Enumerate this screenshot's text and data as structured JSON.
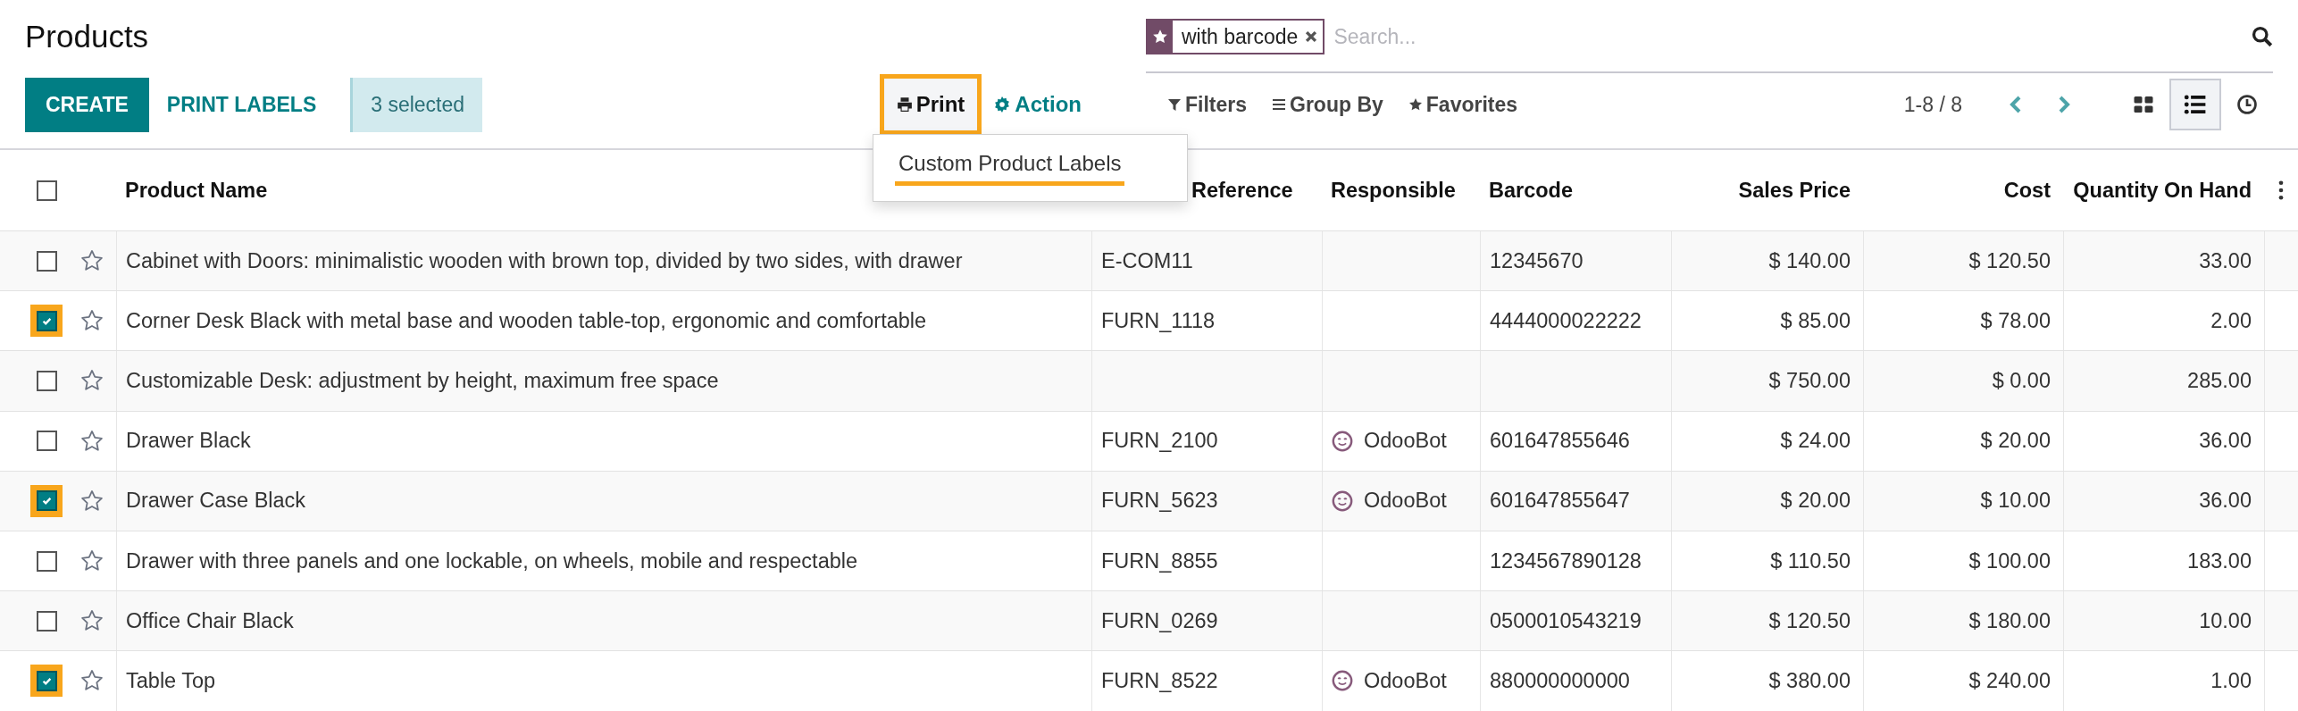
{
  "title": "Products",
  "search": {
    "facet": "with barcode",
    "placeholder": "Search..."
  },
  "create": "CREATE",
  "print_labels": "PRINT LABELS",
  "selection": "3 selected",
  "print": {
    "label": "Print",
    "highlighted": true
  },
  "action": {
    "label": "Action"
  },
  "print_menu": {
    "items": [
      {
        "label": "Custom Product Labels",
        "highlighted": true
      }
    ]
  },
  "search_options": [
    {
      "kind": "filter",
      "label": "Filters"
    },
    {
      "kind": "group",
      "label": "Group By"
    },
    {
      "kind": "favorite",
      "label": "Favorites"
    }
  ],
  "pager": "1-8 / 8",
  "views": [
    {
      "kind": "kanban",
      "selected": false
    },
    {
      "kind": "list",
      "selected": true
    },
    {
      "kind": "activity",
      "selected": false
    }
  ],
  "table": {
    "all_selected": false,
    "columns": [
      "Product Name",
      "Reference",
      "Responsible",
      "Barcode",
      "Sales Price",
      "Cost",
      "Quantity On Hand"
    ],
    "rows": [
      {
        "selected": false,
        "starred": false,
        "name": "Cabinet with Doors: minimalistic wooden with brown top, divided by two sides, with drawer",
        "reference": "E-COM11",
        "barcode": "12345670",
        "sales_price": "$ 140.00",
        "cost": "$ 120.50",
        "quantity": "33.00"
      },
      {
        "selected": true,
        "starred": false,
        "name": "Corner Desk Black with metal base and wooden table-top, ergonomic and comfortable",
        "reference": "FURN_1118",
        "barcode": "4444000022222",
        "sales_price": "$ 85.00",
        "cost": "$ 78.00",
        "quantity": "2.00"
      },
      {
        "selected": false,
        "starred": false,
        "name": "Customizable Desk: adjustment by height, maximum free space",
        "sales_price": "$ 750.00",
        "cost": "$ 0.00",
        "quantity": "285.00"
      },
      {
        "selected": false,
        "starred": false,
        "name": "Drawer Black",
        "reference": "FURN_2100",
        "responsible": "OdooBot",
        "barcode": "601647855646",
        "sales_price": "$ 24.00",
        "cost": "$ 20.00",
        "quantity": "36.00"
      },
      {
        "selected": true,
        "starred": false,
        "name": "Drawer Case Black",
        "reference": "FURN_5623",
        "responsible": "OdooBot",
        "barcode": "601647855647",
        "sales_price": "$ 20.00",
        "cost": "$ 10.00",
        "quantity": "36.00"
      },
      {
        "selected": false,
        "starred": false,
        "name": "Drawer with three panels and one lockable, on wheels, mobile and respectable",
        "reference": "FURN_8855",
        "barcode": "1234567890128",
        "sales_price": "$ 110.50",
        "cost": "$ 100.00",
        "quantity": "183.00"
      },
      {
        "selected": false,
        "starred": false,
        "name": "Office Chair Black",
        "reference": "FURN_0269",
        "barcode": "0500010543219",
        "sales_price": "$ 120.50",
        "cost": "$ 180.00",
        "quantity": "10.00"
      },
      {
        "selected": true,
        "starred": false,
        "name": "Table Top",
        "reference": "FURN_8522",
        "responsible": "OdooBot",
        "barcode": "880000000000",
        "sales_price": "$ 380.00",
        "cost": "$ 240.00",
        "quantity": "1.00"
      }
    ]
  }
}
